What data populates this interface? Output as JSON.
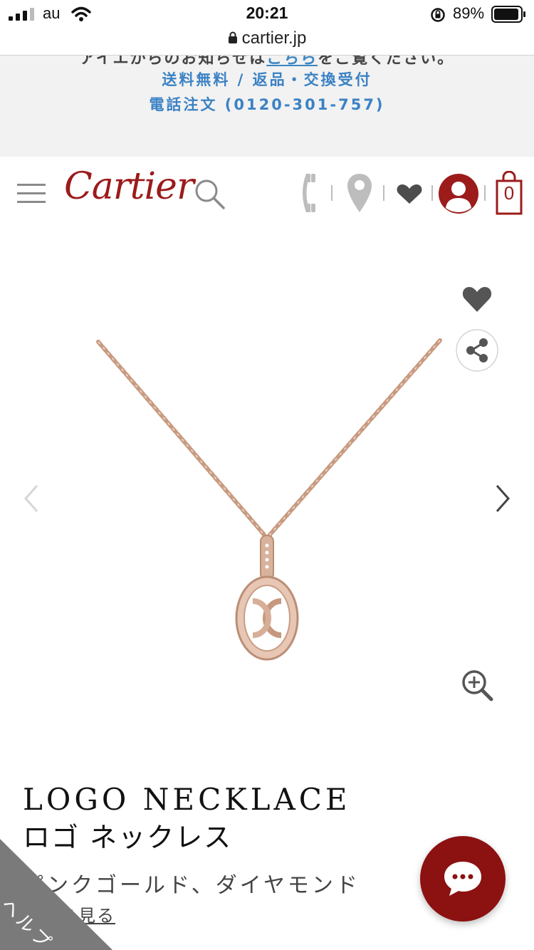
{
  "status_bar": {
    "carrier": "au",
    "time": "20:21",
    "battery": "89%"
  },
  "browser": {
    "url": "cartier.jp"
  },
  "banner": {
    "partial_line_before": "アイエからのお知らせは",
    "partial_line_link": "こちら",
    "partial_line_after": "をご覧ください。",
    "line1": "送料無料 / 返品・交換受付",
    "line2": "電話注文 (0120-301-757)"
  },
  "header": {
    "logo": "Cartier",
    "cart_count": "0"
  },
  "product": {
    "title_en": "LOGO NECKLACE",
    "title_jp": "ロゴ ネックレス",
    "description": "ピンクゴールド、ダイヤモンド",
    "more_link": "詳細を見る"
  },
  "help": {
    "label": "ヘルプ"
  },
  "colors": {
    "brand_red": "#9c1b1b",
    "link_blue": "#3b82c4",
    "chat_red": "#8c1111"
  },
  "icons": {
    "menu": "hamburger-icon",
    "search": "search-icon",
    "phone": "phone-icon",
    "store": "location-pin-icon",
    "wishlist": "heart-icon",
    "account": "user-icon",
    "cart": "shopping-bag-icon",
    "share": "share-icon",
    "zoom": "zoom-in-icon",
    "prev": "chevron-left-icon",
    "next": "chevron-right-icon",
    "chat": "chat-bubble-icon"
  }
}
